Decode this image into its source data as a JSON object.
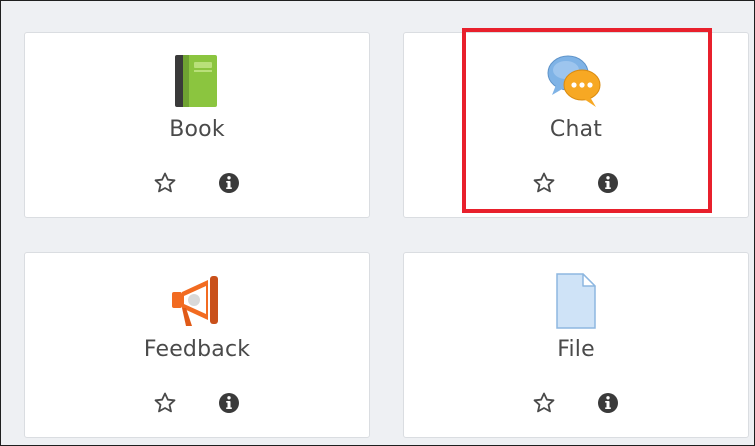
{
  "modules": [
    {
      "name": "Book",
      "icon": "book-icon"
    },
    {
      "name": "Chat",
      "icon": "chat-icon"
    },
    {
      "name": "Feedback",
      "icon": "megaphone-icon"
    },
    {
      "name": "File",
      "icon": "file-icon"
    }
  ],
  "actions": {
    "star_icon": "star-outline-icon",
    "info_icon": "info-circle-icon"
  },
  "colors": {
    "highlight": "#e8202c",
    "card_bg": "#ffffff",
    "page_bg": "#eef0f3",
    "label_text": "#4a4a4a",
    "book_green": "#8bc53f",
    "chat_blue": "#6fa8dc",
    "chat_orange": "#f7a823",
    "feedback_orange": "#f26b21",
    "file_blue": "#cfe3f7"
  }
}
